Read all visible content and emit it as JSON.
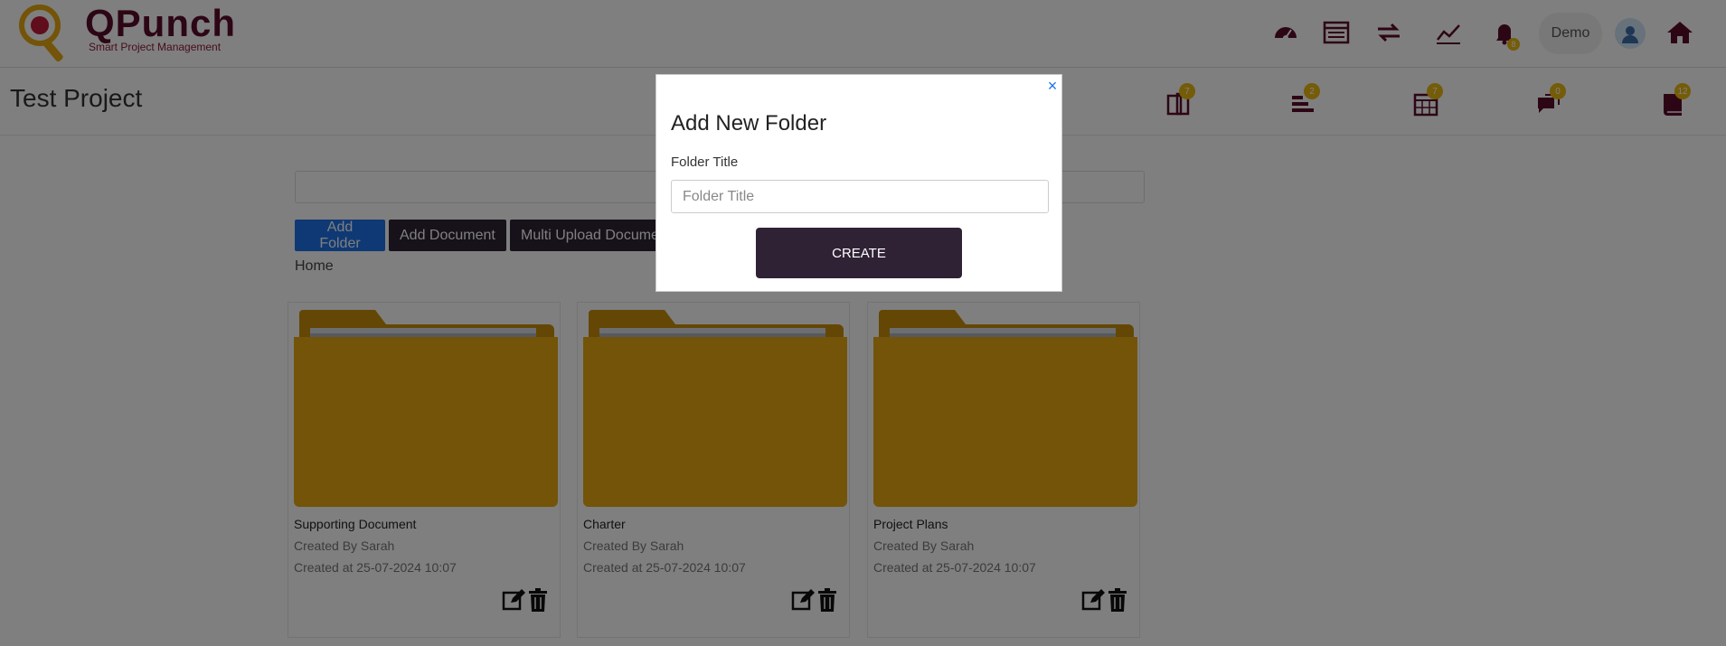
{
  "header": {
    "logo_title": "QPunch",
    "logo_subtitle": "Smart Project Management",
    "notification_count": "8",
    "user_name": "Demo",
    "icons": [
      "dashboard-icon",
      "list-icon",
      "sync-icon",
      "chart-icon",
      "bell-icon",
      "avatar-icon",
      "home-icon"
    ]
  },
  "project": {
    "title": "Test Project",
    "tabs": [
      {
        "icon": "tab-1-icon",
        "badge": "7"
      },
      {
        "icon": "tab-2-icon",
        "badge": "2"
      },
      {
        "icon": "calendar-icon",
        "badge": "7"
      },
      {
        "icon": "chat-icon",
        "badge": "0"
      },
      {
        "icon": "book-icon",
        "badge": "12"
      }
    ]
  },
  "toolbar": {
    "add_folder": "Add Folder",
    "add_document": "Add Document",
    "multi_upload": "Multi Upload Docume"
  },
  "breadcrumb": {
    "home": "Home"
  },
  "folders": [
    {
      "name": "Supporting Document",
      "created_by": "Created By Sarah",
      "created_at": "Created at 25-07-2024 10:07"
    },
    {
      "name": "Charter",
      "created_by": "Created By Sarah",
      "created_at": "Created at 25-07-2024 10:07"
    },
    {
      "name": "Project Plans",
      "created_by": "Created By Sarah",
      "created_at": "Created at 25-07-2024 10:07"
    }
  ],
  "modal": {
    "close": "×",
    "title": "Add New Folder",
    "label": "Folder Title",
    "placeholder": "Folder Title",
    "value": "",
    "create_button": "CREATE"
  },
  "colors": {
    "brand": "#5a0c2a",
    "primary_blue": "#1e73e8",
    "dark_button": "#2f2234",
    "badge": "#e8b810",
    "folder": "#e6a910"
  }
}
